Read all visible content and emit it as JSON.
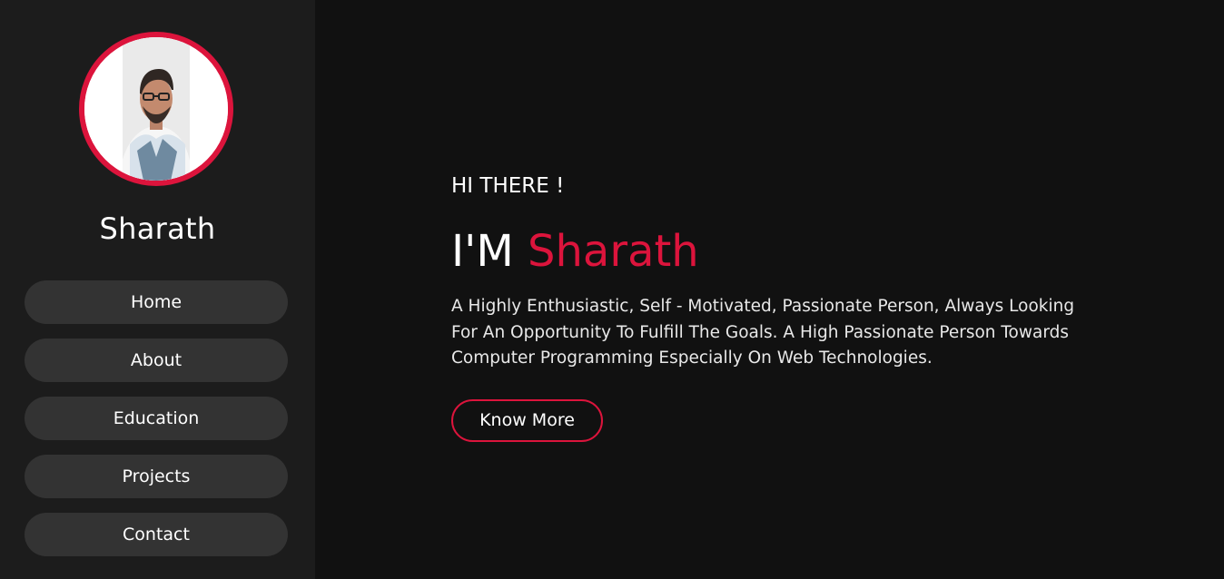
{
  "sidebar": {
    "name": "Sharath",
    "nav": [
      {
        "label": "Home"
      },
      {
        "label": "About"
      },
      {
        "label": "Education"
      },
      {
        "label": "Projects"
      },
      {
        "label": "Contact"
      }
    ]
  },
  "hero": {
    "greeting": "HI THERE !",
    "prefix": "I'M ",
    "name": "Sharath",
    "description": "A Highly Enthusiastic, Self - Motivated, Passionate Person, Always Looking For An Opportunity To Fulfill The Goals. A High Passionate Person Towards Computer Programming Especially On Web Technologies.",
    "button_label": "Know More"
  },
  "colors": {
    "accent": "#dc143c",
    "sidebar_bg": "#1c1c1c",
    "main_bg": "#111111",
    "nav_item_bg": "#333333"
  },
  "icons": {
    "profile_photo": "profile-photo"
  }
}
